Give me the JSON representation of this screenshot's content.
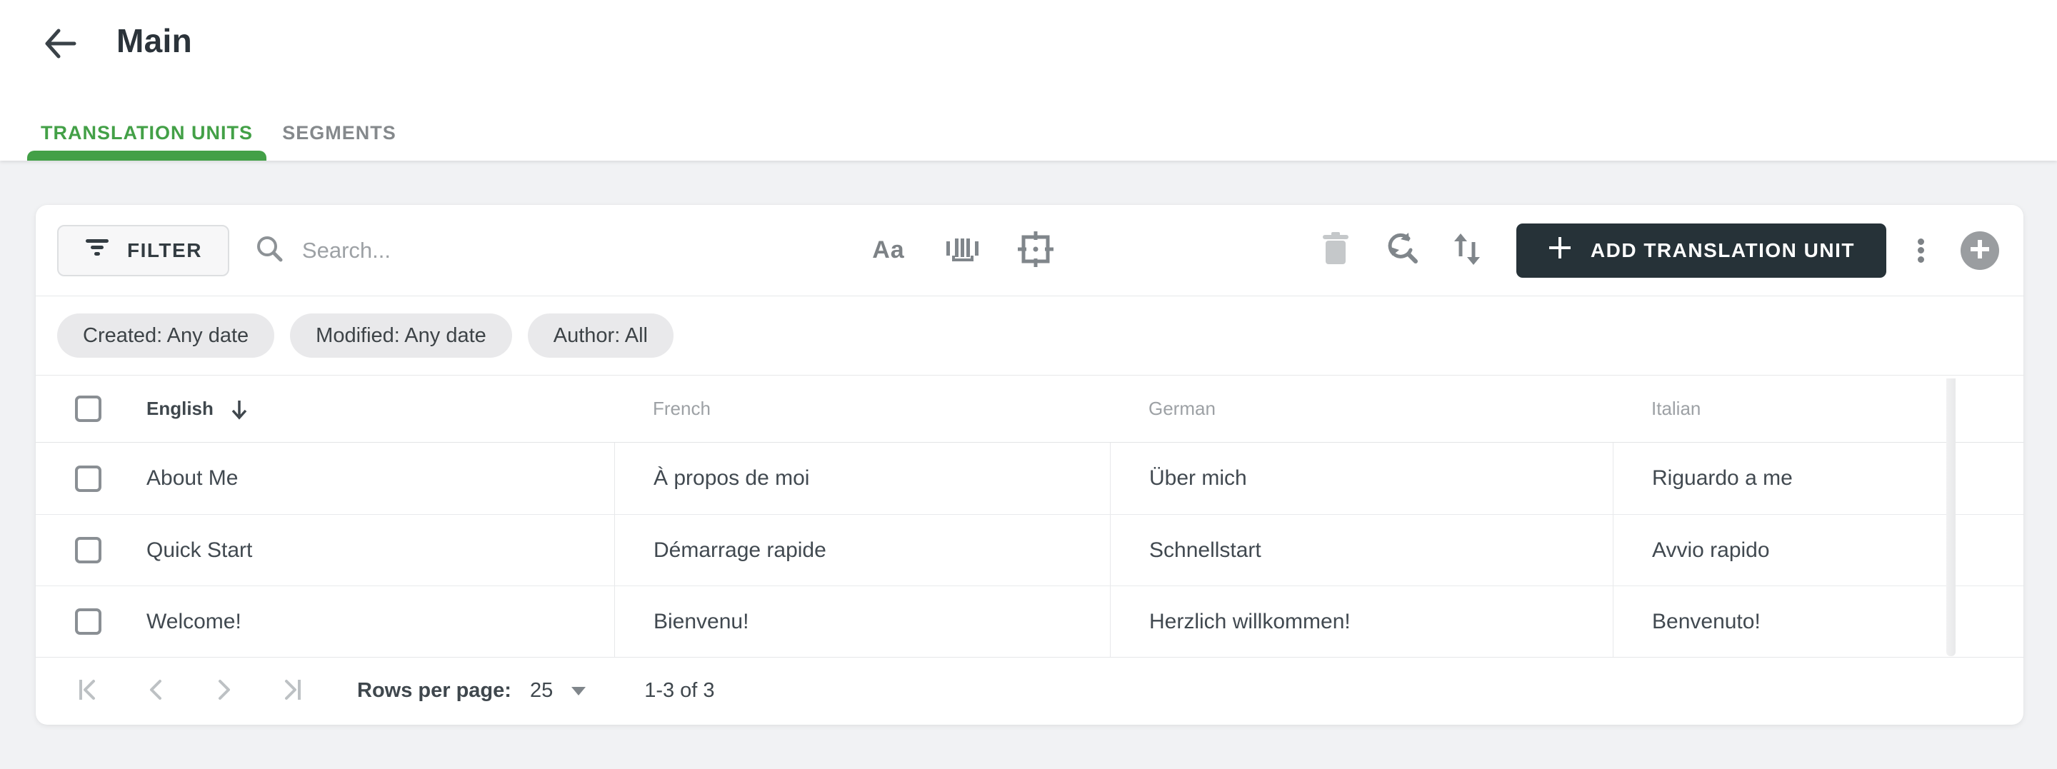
{
  "header": {
    "title": "Main"
  },
  "tabs": [
    {
      "label": "TRANSLATION UNITS",
      "active": true
    },
    {
      "label": "SEGMENTS",
      "active": false
    }
  ],
  "toolbar": {
    "filter_label": "FILTER",
    "search_placeholder": "Search...",
    "match_case_glyph": "Aa",
    "add_button_label": "ADD TRANSLATION UNIT"
  },
  "filters": [
    "Created: Any date",
    "Modified: Any date",
    "Author: All"
  ],
  "table": {
    "columns": [
      "English",
      "French",
      "German",
      "Italian"
    ],
    "sort": {
      "column": "English",
      "direction": "desc"
    },
    "rows": [
      [
        "About Me",
        "À propos de moi",
        "Über mich",
        "Riguardo a me"
      ],
      [
        "Quick Start",
        "Démarrage rapide",
        "Schnellstart",
        "Avvio rapido"
      ],
      [
        "Welcome!",
        "Bienvenu!",
        "Herzlich willkommen!",
        "Benvenuto!"
      ]
    ]
  },
  "pagination": {
    "rows_per_page_label": "Rows per page:",
    "rows_per_page": "25",
    "range": "1-3 of 3"
  },
  "icons": {
    "back": "arrow-left",
    "filter": "filter-lines",
    "search": "magnifier",
    "match_case": "Aa",
    "whole_words": "barcode-brackets",
    "selection": "crosshair-frame",
    "delete": "trash",
    "refresh_search": "circular-arrows-magnifier",
    "sort": "arrows-up-down",
    "add": "plus",
    "more": "vertical-ellipsis",
    "add_circle": "plus-circle",
    "sort_direction": "arrow-down",
    "pager": [
      "first-page",
      "previous-page",
      "next-page",
      "last-page"
    ],
    "rows_per_page_caret": "triangle-down"
  },
  "colors": {
    "accent_green": "#43a047",
    "dark_button": "#263238",
    "page_background": "#f1f2f4",
    "chip_background": "#e9e9eb",
    "icon_gray": "#7d8286",
    "disabled_gray": "#c5c8ca"
  }
}
